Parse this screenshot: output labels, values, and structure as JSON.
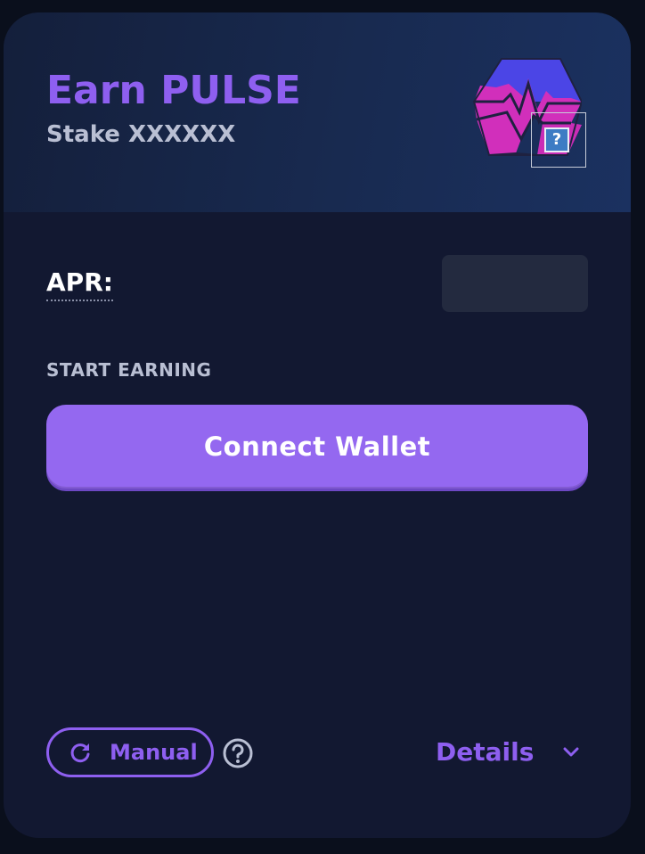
{
  "pool": {
    "title": "Earn PULSE",
    "subtitle": "Stake XXXXXX",
    "logo_icon": "pulse-token-logo",
    "missing_image_icon": "broken-image-icon",
    "missing_image_glyph": "?"
  },
  "apr": {
    "label": "APR:"
  },
  "actions": {
    "start_label": "START EARNING",
    "connect_label": "Connect Wallet"
  },
  "footer": {
    "manual_label": "Manual",
    "manual_icon": "refresh-icon",
    "help_icon": "question-circle-icon",
    "details_label": "Details",
    "details_icon": "chevron-down-icon"
  },
  "colors": {
    "accent": "#8e5ff0",
    "button": "#9468f0",
    "card_background": "#121831",
    "header_background": "#182a50",
    "secondary_text": "#b9bfd3"
  }
}
